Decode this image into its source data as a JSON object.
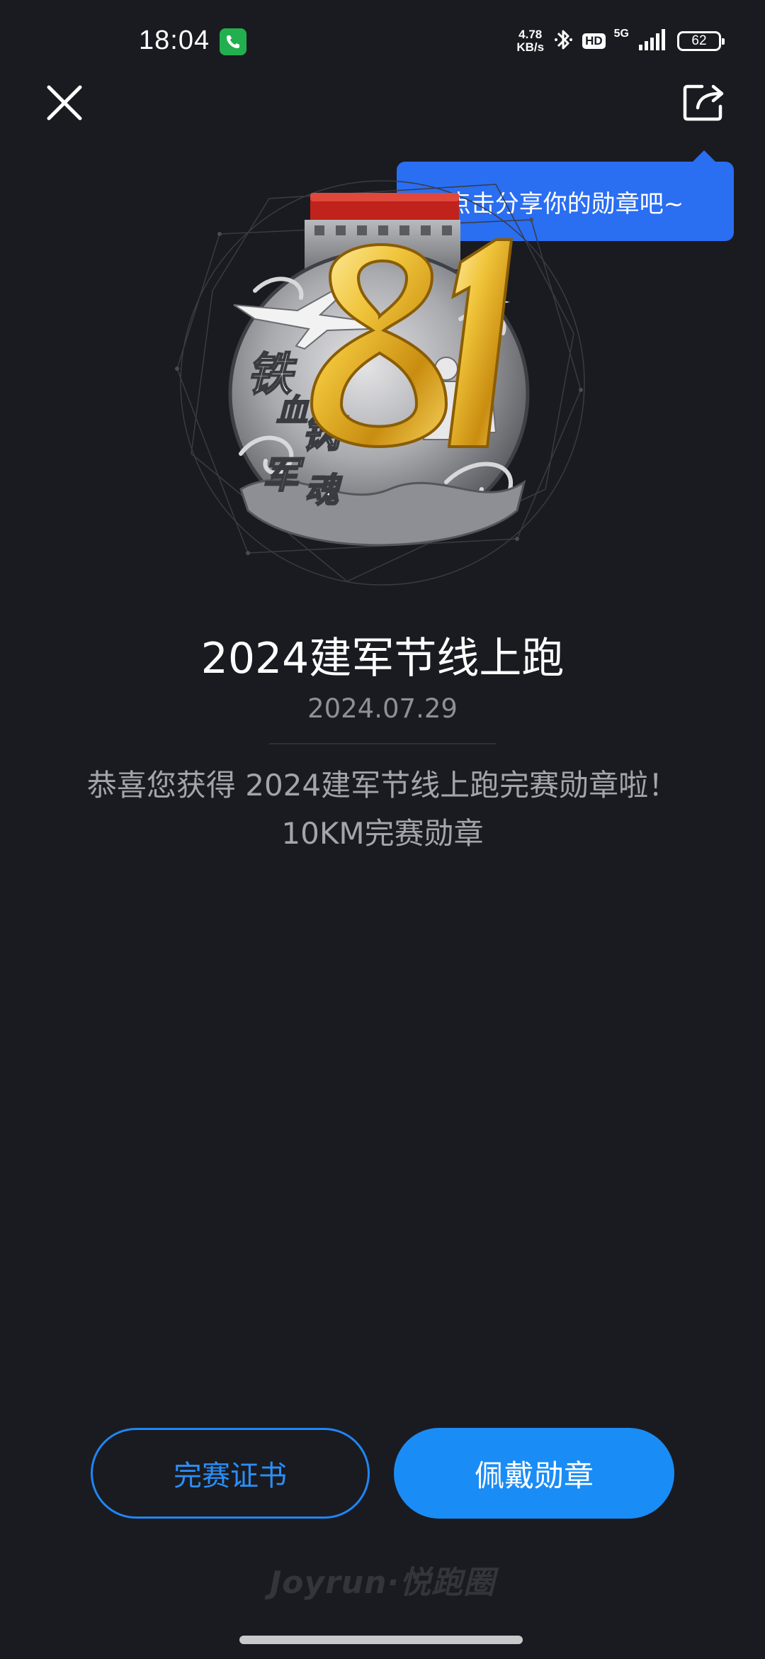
{
  "status_bar": {
    "time": "18:04",
    "net_speed_value": "4.78",
    "net_speed_unit": "KB/s",
    "hd_label": "HD",
    "network_label": "5G",
    "battery_level": "62",
    "call_icon": "phone-icon",
    "bluetooth_icon": "bluetooth-icon",
    "signal_icon": "signal-icon"
  },
  "header": {
    "close_icon": "close-icon",
    "share_icon": "share-icon"
  },
  "tooltip": {
    "text": "点击分享你的勋章吧~"
  },
  "medal": {
    "artwork_number": "81"
  },
  "content": {
    "title": "2024建军节线上跑",
    "date": "2024.07.29",
    "congrats": "恭喜您获得 2024建军节线上跑完赛勋章啦！",
    "subtitle": "10KM完赛勋章"
  },
  "actions": {
    "certificate_label": "完赛证书",
    "wear_label": "佩戴勋章"
  },
  "footer": {
    "brand": "Joyrun·悦跑圈"
  },
  "colors": {
    "background": "#1a1b20",
    "accent_blue": "#1a8cf6",
    "tooltip_blue": "#2a6ef2",
    "gold": "#e8b52a"
  }
}
